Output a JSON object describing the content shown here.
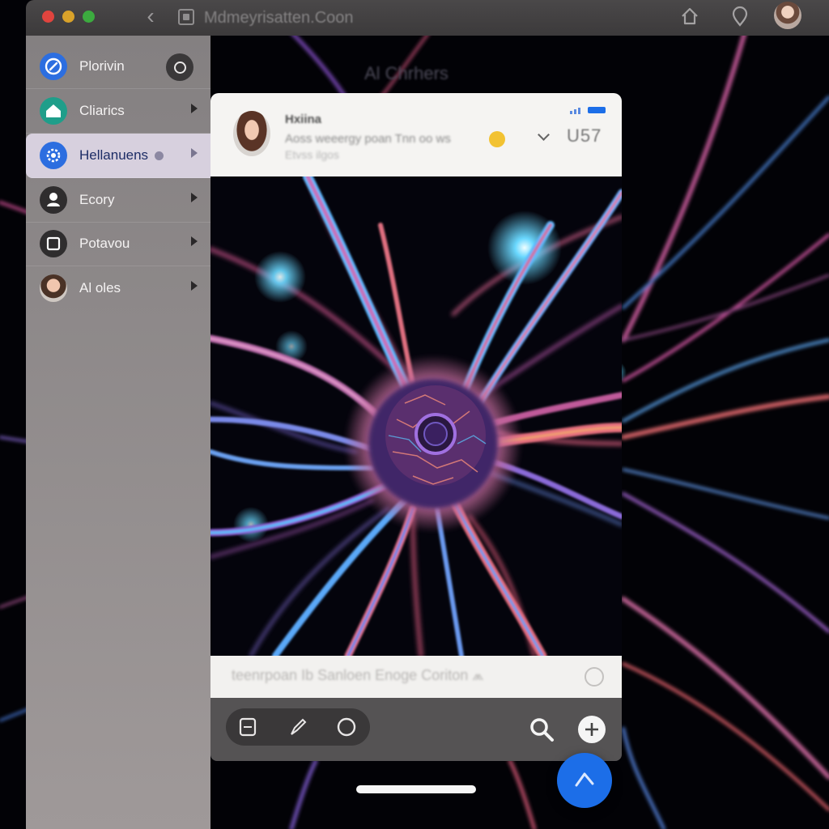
{
  "browser": {
    "url": "Mdmeyrisatten.Coon",
    "back_icon": "chevron-left-icon",
    "tabs_icon": "tabs-icon",
    "home_icon": "home-icon",
    "location_icon": "location-pin-icon"
  },
  "sidebar": {
    "items": [
      {
        "label": "Plorivin",
        "icon": "link-icon",
        "color": "#2c6ee0",
        "control": "toggle"
      },
      {
        "label": "Cliarics",
        "icon": "home-icon",
        "color": "#1f9e8a",
        "control": "chevron"
      },
      {
        "label": "Hellanuens",
        "icon": "gear-icon",
        "color": "#2c6ee0",
        "control": "chevron",
        "active": true
      },
      {
        "label": "Ecory",
        "icon": "person-icon",
        "color": "#2f2d2e",
        "control": "chevron"
      },
      {
        "label": "Potavou",
        "icon": "square-icon",
        "color": "#2f2d2e",
        "control": "chevron"
      },
      {
        "label": "Al oles",
        "icon": "avatar",
        "control": "chevron"
      }
    ]
  },
  "background_title": "Al Chrhers",
  "chat": {
    "contact_name": "Hxiina",
    "preview": "Aoss weeergy poan  Tnn  oo  ws",
    "subtext": "Etvss ilgos",
    "time": "U57"
  },
  "compose": {
    "placeholder": "teenrpoan  Ib  Sanloen  Enoge  Coriton  ⩕"
  },
  "toolbar": {
    "tools": [
      "document-icon",
      "pen-icon",
      "circle-icon"
    ],
    "search_icon": "search-icon",
    "add_icon": "add-icon"
  },
  "fab_icon": "arrow-up-icon",
  "colors": {
    "accent": "#1c6ee8",
    "sidebar_active": "#d7d0de",
    "neuron_blue": "#5ab8ff",
    "neuron_pink": "#e0708a"
  }
}
